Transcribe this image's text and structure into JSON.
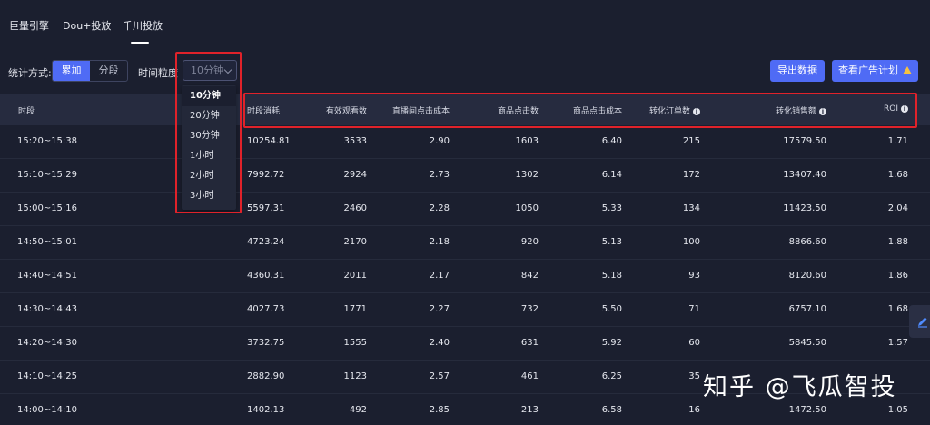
{
  "tabs": [
    {
      "label": "巨量引擎"
    },
    {
      "label": "Dou+投放"
    },
    {
      "label": "千川投放"
    }
  ],
  "toolbar": {
    "stat_label": "统计方式:",
    "mode_options": [
      "累加",
      "分段"
    ],
    "granularity_label": "时间粒度",
    "granularity_value": "10分钟",
    "export_label": "导出数据",
    "plan_label": "查看广告计划"
  },
  "dropdown": {
    "options": [
      "10分钟",
      "20分钟",
      "30分钟",
      "1小时",
      "2小时",
      "3小时"
    ]
  },
  "table": {
    "headers": [
      "时段",
      "时段消耗",
      "有效观看数",
      "直播间点击成本",
      "商品点击数",
      "商品点击成本",
      "转化订单数",
      "转化销售额",
      "ROI"
    ],
    "rows": [
      [
        "15:20~15:38",
        "10254.81",
        "3533",
        "2.90",
        "1603",
        "6.40",
        "215",
        "17579.50",
        "1.71"
      ],
      [
        "15:10~15:29",
        "7992.72",
        "2924",
        "2.73",
        "1302",
        "6.14",
        "172",
        "13407.40",
        "1.68"
      ],
      [
        "15:00~15:16",
        "5597.31",
        "2460",
        "2.28",
        "1050",
        "5.33",
        "134",
        "11423.50",
        "2.04"
      ],
      [
        "14:50~15:01",
        "4723.24",
        "2170",
        "2.18",
        "920",
        "5.13",
        "100",
        "8866.60",
        "1.88"
      ],
      [
        "14:40~14:51",
        "4360.31",
        "2011",
        "2.17",
        "842",
        "5.18",
        "93",
        "8120.60",
        "1.86"
      ],
      [
        "14:30~14:43",
        "4027.73",
        "1771",
        "2.27",
        "732",
        "5.50",
        "71",
        "6757.10",
        "1.68"
      ],
      [
        "14:20~14:30",
        "3732.75",
        "1555",
        "2.40",
        "631",
        "5.92",
        "60",
        "5845.50",
        "1.57"
      ],
      [
        "14:10~14:25",
        "2882.90",
        "1123",
        "2.57",
        "461",
        "6.25",
        "35",
        "",
        ""
      ],
      [
        "14:00~14:10",
        "1402.13",
        "492",
        "2.85",
        "213",
        "6.58",
        "16",
        "1472.50",
        "1.05"
      ]
    ]
  },
  "watermark": "知乎 @飞瓜智投",
  "colors": {
    "accent": "#4f6bf5",
    "highlight": "#e0222a",
    "warning": "#f5c242"
  }
}
